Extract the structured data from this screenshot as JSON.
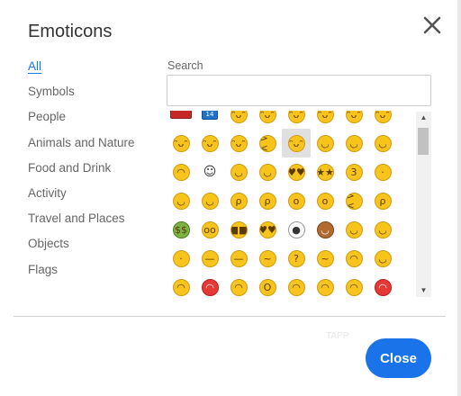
{
  "dialog": {
    "title": "Emoticons",
    "close_icon": "close-icon",
    "close_button_label": "Close",
    "watermark": "TAPP"
  },
  "categories": [
    {
      "label": "All",
      "active": true
    },
    {
      "label": "Symbols",
      "active": false
    },
    {
      "label": "People",
      "active": false
    },
    {
      "label": "Animals and Nature",
      "active": false
    },
    {
      "label": "Food and Drink",
      "active": false
    },
    {
      "label": "Activity",
      "active": false
    },
    {
      "label": "Travel and Places",
      "active": false
    },
    {
      "label": "Objects",
      "active": false
    },
    {
      "label": "Flags",
      "active": false
    }
  ],
  "search": {
    "label": "Search",
    "value": "",
    "placeholder": ""
  },
  "emoji_grid": {
    "rows": [
      [
        "flag-red",
        "calendar-blue",
        "grin-face",
        "grin-face",
        "grin-face",
        "grin-face",
        "grin-face",
        "grin-face"
      ],
      [
        "grin-face",
        "grin-face",
        "sweat-smile-face",
        "laugh-squint-face",
        "halo-face",
        "smile-face",
        "smile-face",
        "slight-smile-face"
      ],
      [
        "upside-down-face",
        "white-smile-face",
        "yum-face",
        "relieved-face",
        "heart-eyes-face",
        "star-struck-face",
        "kiss-face",
        "neutral-face"
      ],
      [
        "squint-face",
        "smirk-face",
        "wink-tongue-face",
        "zany-face",
        "hush-face",
        "monocle-face",
        "squint-tongue-face",
        "tongue-face"
      ],
      [
        "money-face",
        "nerd-face",
        "sunglasses-face",
        "heart-eyes-face",
        "clown-face",
        "cowboy-face",
        "hug-face",
        "smirk-face"
      ],
      [
        "neutral-face",
        "expressionless-face",
        "unamused-face",
        "rolling-eyes-face",
        "thinking-face",
        "confused-face",
        "worried-face",
        "smirk-face"
      ],
      [
        "sad-face",
        "angry-red-face",
        "hot-face",
        "shock-face",
        "pensive-face",
        "frown-face",
        "angry-face",
        "red-pout-face"
      ]
    ],
    "selected": {
      "row": 1,
      "col": 4
    },
    "colors": {
      "face": "#f7c31d",
      "selected_bg": "#e0e0e0"
    }
  },
  "scrollbar": {
    "up_arrow": "▲",
    "down_arrow": "▼"
  },
  "colors": {
    "accent": "#1a73e8",
    "text": "#333333",
    "muted": "#666666"
  }
}
